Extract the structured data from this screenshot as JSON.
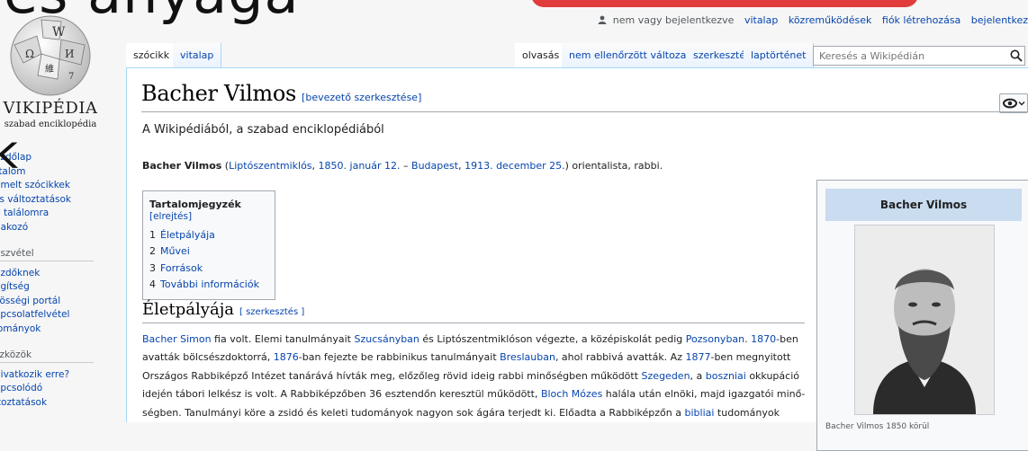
{
  "overlay": {
    "text": "es anyaga",
    "corner_letter": "k"
  },
  "personal_tools": {
    "not_logged_in": "nem vagy bejelentkezve",
    "items": [
      "vitalap",
      "közreműködések",
      "fiók létrehozása",
      "bejelentkez"
    ]
  },
  "logo": {
    "wordmark": "VIKIPÉDIA",
    "tagline": "szabad enciklopédia"
  },
  "sidebar": {
    "nav_items": [
      "ezdőlap",
      "rtalom",
      "emelt szócikkek",
      "ss változtatások",
      "p találomra",
      "dakozó"
    ],
    "participation_head": "észvétel",
    "participation_items": [
      "ezdőknek",
      "egítség",
      "zösségi portál",
      "apcsolatfelvétel",
      "lományok"
    ],
    "tools_head": "szközök",
    "tools_items": [
      "hivatkozik erre?",
      "apcsolódó",
      "ltoztatások"
    ]
  },
  "tabs": {
    "left": [
      "szócikk",
      "vitalap"
    ],
    "right": [
      "olvasás",
      "nem ellenőrzött változat",
      "szerkesztés",
      "laptörténet"
    ],
    "search_placeholder": "Keresés a Wikipédián"
  },
  "page": {
    "title": "Bacher Vilmos",
    "title_edit": "[bevezető szerkesztése]",
    "site_sub": "A Wikipédiából, a szabad enciklopédiából",
    "lead": {
      "bold_name": "Bacher Vilmos",
      "open_paren": " (",
      "birthplace": "Liptószentmiklós",
      "comma": ", ",
      "birth_date": "1850. január 12.",
      "dash": " – ",
      "death_place": "Budapest",
      "comma2": ", ",
      "death_date": "1913. december 25.",
      "close": ") orientalista, rabbi."
    },
    "toc": {
      "title": "Tartalomjegyzék",
      "toggle": "[elrejtés]",
      "items": [
        {
          "num": "1",
          "label": "Életpályája"
        },
        {
          "num": "2",
          "label": "Művei"
        },
        {
          "num": "3",
          "label": "Források"
        },
        {
          "num": "4",
          "label": "További információk"
        }
      ]
    },
    "section": {
      "title": "Életpályája",
      "edit": "[ szerkesztés ]"
    },
    "paragraph": {
      "l1": [
        "Bacher Simon",
        " fia volt. Elemi tanulmányait ",
        "Szucsányban",
        " és Liptószentmiklóson végezte, a középiskolát pedig ",
        "Pozsonyban",
        ". ",
        "1870",
        "-ben"
      ],
      "l2": [
        "avatták bölcsészdoktorrá, ",
        "1876",
        "-ban fejezte be rabbinikus tanulmányait ",
        "Breslauban",
        ", ahol rabbivá avatták. Az ",
        "1877",
        "-ben megnyitott"
      ],
      "l3": [
        "Országos Rabbiképző Intézet tanárává hívták meg, előzőleg rövid ideig rabbi minőségben működött ",
        "Szegeden",
        ", a ",
        "boszniai",
        " okkupáció"
      ],
      "l4": [
        "idején tábori lelkész is volt. A Rabbiképzőben 36 esztendőn keresztül működött, ",
        "Bloch Mózes",
        " halála után elnöki, majd igazgatói minő-"
      ],
      "l5": [
        "ségben. Tanulmányi köre a zsidó és keleti tudományok nagyon sok ágára terjedt ki. Előadta a Rabbiképzőn a ",
        "bibliai",
        " tudományok"
      ]
    }
  },
  "infobox": {
    "title": "Bacher Vilmos",
    "caption": "Bacher Vilmos 1850 körül"
  },
  "colors": {
    "link": "#0645ad",
    "infobox_header": "#c9dcf0",
    "tab_border": "#a7d7f9"
  }
}
